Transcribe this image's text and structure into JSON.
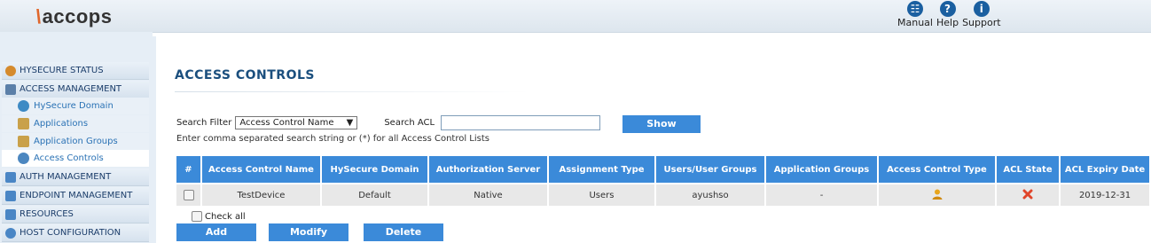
{
  "brand": {
    "logo_text": "accops"
  },
  "top_links": [
    {
      "label": "Manual",
      "icon": "manual-icon",
      "glyph": "☷"
    },
    {
      "label": "Help",
      "icon": "help-icon",
      "glyph": "?"
    },
    {
      "label": "Support",
      "icon": "info-icon",
      "glyph": "i"
    }
  ],
  "sidebar": {
    "items": [
      {
        "label": "HYSECURE STATUS",
        "icon": "status-icon"
      },
      {
        "label": "ACCESS MANAGEMENT",
        "icon": "access-management-icon"
      },
      {
        "label": "HySecure Domain",
        "icon": "domain-icon"
      },
      {
        "label": "Applications",
        "icon": "applications-icon"
      },
      {
        "label": "Application Groups",
        "icon": "application-groups-icon"
      },
      {
        "label": "Access Controls",
        "icon": "access-controls-icon"
      },
      {
        "label": "AUTH MANAGEMENT",
        "icon": "auth-management-icon"
      },
      {
        "label": "ENDPOINT MANAGEMENT",
        "icon": "endpoint-management-icon"
      },
      {
        "label": "RESOURCES",
        "icon": "resources-icon"
      },
      {
        "label": "HOST CONFIGURATION",
        "icon": "host-configuration-icon"
      }
    ]
  },
  "page": {
    "title": "ACCESS CONTROLS",
    "search_filter_label": "Search Filter",
    "search_filter_value": "Access Control Name",
    "search_acl_label": "Search ACL",
    "search_acl_value": "",
    "show_button": "Show",
    "hint": "Enter comma separated search string or (*) for all Access Control Lists"
  },
  "table": {
    "headers": [
      "#",
      "Access Control Name",
      "HySecure Domain",
      "Authorization Server",
      "Assignment Type",
      "Users/User Groups",
      "Application Groups",
      "Access Control Type",
      "ACL State",
      "ACL Expiry Date"
    ],
    "rows": [
      {
        "name": "TestDevice",
        "domain": "Default",
        "auth_server": "Native",
        "assignment": "Users",
        "users": "ayushso",
        "app_groups": "-",
        "type_icon": "user-icon",
        "state_icon": "disabled-x-icon",
        "expiry": "2019-12-31"
      }
    ]
  },
  "actions": {
    "check_all": "Check all",
    "add": "Add",
    "modify": "Modify",
    "delete": "Delete"
  },
  "colors": {
    "accent": "#3b8ad9",
    "title": "#1b4f7e",
    "row_bg": "#e8e8e8"
  }
}
